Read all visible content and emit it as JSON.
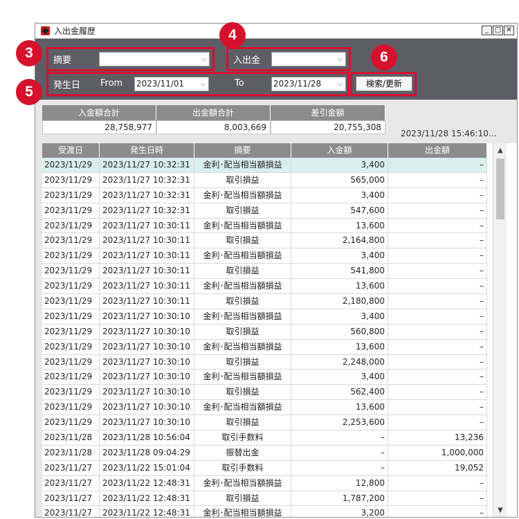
{
  "window": {
    "title": "入出金履歴"
  },
  "filters": {
    "summary_label": "摘要",
    "summary_value": "",
    "inout_label": "入出金",
    "inout_value": "",
    "date_label": "発生日",
    "from_label": "From",
    "from_value": "2023/11/01",
    "to_label": "To",
    "to_value": "2023/11/28",
    "search_button": "検索/更新"
  },
  "annotations": [
    "3",
    "4",
    "5",
    "6"
  ],
  "totals": {
    "deposit_label": "入金額合計",
    "deposit_value": "28,758,977",
    "withdraw_label": "出金額合計",
    "withdraw_value": "8,003,669",
    "diff_label": "差引金額",
    "diff_value": "20,755,308"
  },
  "timestamp": "2023/11/28 15:46:10...",
  "table": {
    "headers": [
      "受渡日",
      "発生日時",
      "摘要",
      "入金額",
      "出金額"
    ],
    "rows": [
      [
        "2023/11/29",
        "2023/11/27 10:32:31",
        "金利･配当相当額損益",
        "3,400",
        "–"
      ],
      [
        "2023/11/29",
        "2023/11/27 10:32:31",
        "取引損益",
        "565,000",
        "–"
      ],
      [
        "2023/11/29",
        "2023/11/27 10:32:31",
        "金利･配当相当額損益",
        "3,400",
        "–"
      ],
      [
        "2023/11/29",
        "2023/11/27 10:32:31",
        "取引損益",
        "547,600",
        "–"
      ],
      [
        "2023/11/29",
        "2023/11/27 10:30:11",
        "金利･配当相当額損益",
        "13,600",
        "–"
      ],
      [
        "2023/11/29",
        "2023/11/27 10:30:11",
        "取引損益",
        "2,164,800",
        "–"
      ],
      [
        "2023/11/29",
        "2023/11/27 10:30:11",
        "金利･配当相当額損益",
        "3,400",
        "–"
      ],
      [
        "2023/11/29",
        "2023/11/27 10:30:11",
        "取引損益",
        "541,800",
        "–"
      ],
      [
        "2023/11/29",
        "2023/11/27 10:30:11",
        "金利･配当相当額損益",
        "13,600",
        "–"
      ],
      [
        "2023/11/29",
        "2023/11/27 10:30:11",
        "取引損益",
        "2,180,800",
        "–"
      ],
      [
        "2023/11/29",
        "2023/11/27 10:30:10",
        "金利･配当相当額損益",
        "3,400",
        "–"
      ],
      [
        "2023/11/29",
        "2023/11/27 10:30:10",
        "取引損益",
        "560,800",
        "–"
      ],
      [
        "2023/11/29",
        "2023/11/27 10:30:10",
        "金利･配当相当額損益",
        "13,600",
        "–"
      ],
      [
        "2023/11/29",
        "2023/11/27 10:30:10",
        "取引損益",
        "2,248,000",
        "–"
      ],
      [
        "2023/11/29",
        "2023/11/27 10:30:10",
        "金利･配当相当額損益",
        "3,400",
        "–"
      ],
      [
        "2023/11/29",
        "2023/11/27 10:30:10",
        "取引損益",
        "562,400",
        "–"
      ],
      [
        "2023/11/29",
        "2023/11/27 10:30:10",
        "金利･配当相当額損益",
        "13,600",
        "–"
      ],
      [
        "2023/11/29",
        "2023/11/27 10:30:10",
        "取引損益",
        "2,253,600",
        "–"
      ],
      [
        "2023/11/28",
        "2023/11/28 10:56:04",
        "取引手数料",
        "–",
        "13,236"
      ],
      [
        "2023/11/28",
        "2023/11/28 09:04:29",
        "振替出金",
        "–",
        "1,000,000"
      ],
      [
        "2023/11/27",
        "2023/11/22 15:01:04",
        "取引手数料",
        "–",
        "19,052"
      ],
      [
        "2023/11/27",
        "2023/11/22 12:48:31",
        "金利･配当相当額損益",
        "12,800",
        "–"
      ],
      [
        "2023/11/27",
        "2023/11/22 12:48:31",
        "取引損益",
        "1,787,200",
        "–"
      ],
      [
        "2023/11/27",
        "2023/11/22 12:48:31",
        "金利･配当相当額損益",
        "3,200",
        "–"
      ]
    ]
  }
}
